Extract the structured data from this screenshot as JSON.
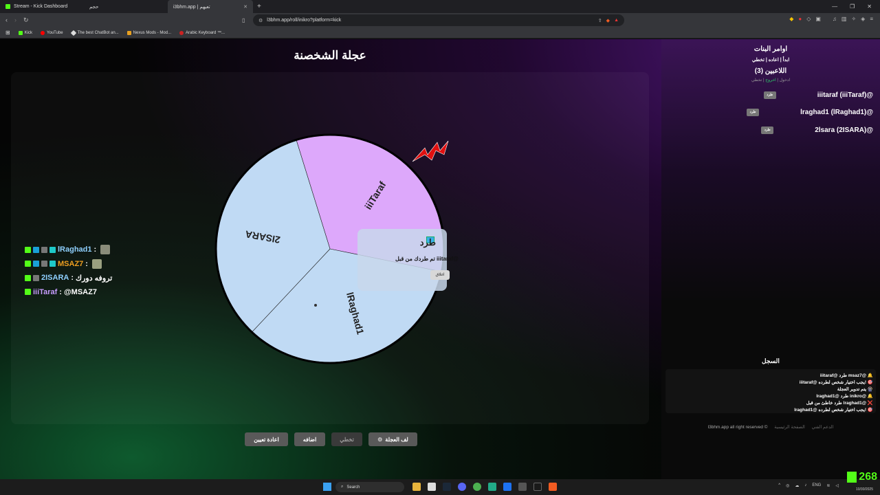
{
  "browser": {
    "tabs": [
      {
        "title": "Stream - Kick Dashboard"
      },
      {
        "title": "i3bhm.app | تعيهم",
        "short": "حجم"
      }
    ],
    "url": "l3bhm.app/roll/inikro?platform=kick",
    "bookmarks": [
      "Kick",
      "YouTube",
      "The best ChatBot an...",
      "Nexus Mods - Mod...",
      "Arabic Keyboard ™..."
    ]
  },
  "page": {
    "title": "عجلة الشخصنة"
  },
  "chat": [
    {
      "user": "lRaghad1",
      "sep": " : ",
      "message": "",
      "user_color": "#8fd0ff"
    },
    {
      "user": "MSAZ7",
      "sep": " : ",
      "message": "",
      "user_color": "#f0a020"
    },
    {
      "user": "2ISARA",
      "sep": " : ",
      "message": "تروفه دورك",
      "user_color": "#8fd0ff"
    },
    {
      "user": "iiiTaraf",
      "sep": " : ",
      "message": "@MSAZ7",
      "user_color": "#c79cff"
    }
  ],
  "wheel": {
    "segments": [
      {
        "label": "iiiTaraf",
        "color": "#dda8fb"
      },
      {
        "label": "lRaghad1",
        "color": "#c0daf4"
      },
      {
        "label": "2ISARA",
        "color": "#c0daf4"
      }
    ]
  },
  "popup": {
    "title": "طرد",
    "message": "تم طردك من قبل iiitaraf@",
    "close": "اغلاق"
  },
  "controls": {
    "reset": "اعادة تعيين",
    "add": "اضافه",
    "skip": "تخطي",
    "spin": "لف العجلة"
  },
  "sidebar": {
    "title": "اوامر البنات",
    "commands": "ابدأ | اعاده | تخطي",
    "players_title": "اللاعبين (3)",
    "sub_enter": "ادخول",
    "sub_exit": "اخروج",
    "sub_skip": "تخطي",
    "kick_label": "طرد",
    "players": [
      {
        "name": "iiitaraf (iiiTaraf)@"
      },
      {
        "name": "lraghad1 (lRaghad1)@"
      },
      {
        "name": "2lsara (2ISARA)@"
      }
    ],
    "log_title": "السجل",
    "log": [
      "iiitaraf@ طرد msaz7@ 🔔",
      "iiitaraf@ يجب اختيار شخص لطرده! 🎯",
      "يتم تدوير العجلة 🎡",
      "lraghad1@ طرد inikro@ 🔔",
      "طرد خاطئ من قبل lraghad1@ ❌",
      "lraghad1@ يجب اختيار شخص لطرده! 🎯"
    ],
    "footer_copy": "l3bhm.app all right reserved ©",
    "footer_support": "الدعم الفني",
    "footer_home": "الصفحة الرئيسية"
  },
  "taskbar": {
    "search": "Search",
    "lang": "ENG",
    "date": "10/30/2025",
    "kick_count": "268"
  }
}
